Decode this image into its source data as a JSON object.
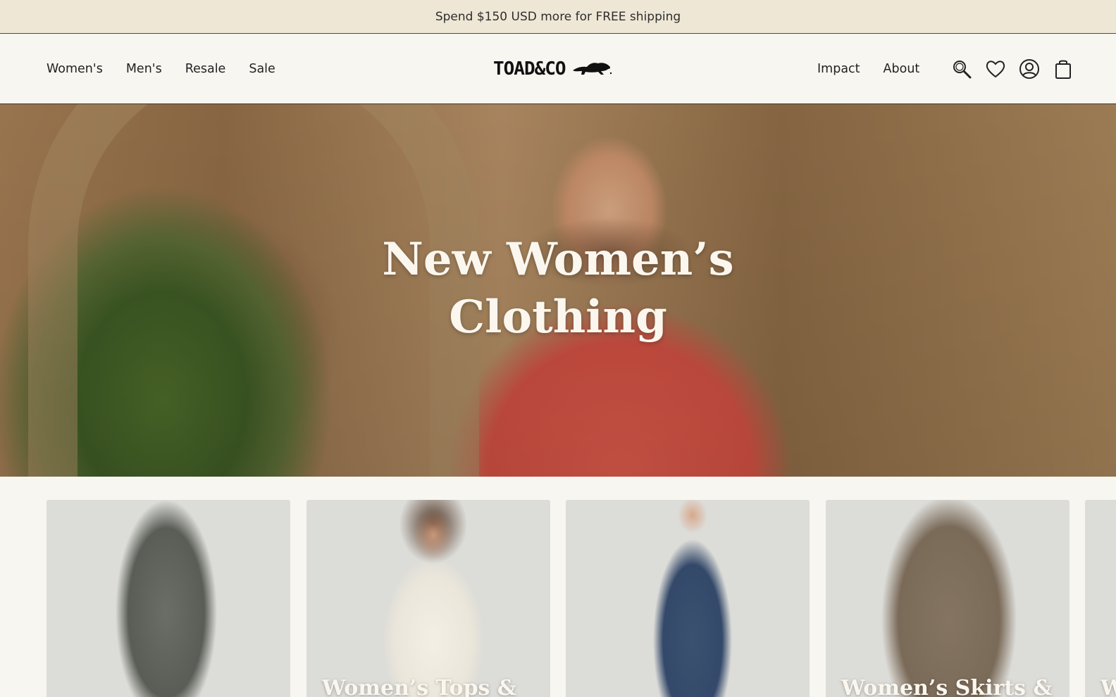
{
  "promo": {
    "text": "Spend $150 USD more for FREE shipping"
  },
  "nav": {
    "left": [
      {
        "label": "Women's"
      },
      {
        "label": "Men's"
      },
      {
        "label": "Resale"
      },
      {
        "label": "Sale"
      }
    ],
    "right": [
      {
        "label": "Impact"
      },
      {
        "label": "About"
      }
    ]
  },
  "logo": {
    "text": "TOAD&CO"
  },
  "icons": [
    "search-icon",
    "heart-icon",
    "account-icon",
    "bag-icon"
  ],
  "hero": {
    "title_line1": "New Women’s",
    "title_line2": "Clothing"
  },
  "cards": [
    {
      "label": ""
    },
    {
      "label": "Women’s Tops &"
    },
    {
      "label": ""
    },
    {
      "label": "Women’s Skirts &"
    },
    {
      "label": "W"
    }
  ],
  "colors": {
    "promo_bg": "#efe7d6",
    "page_bg": "#f8f6f1",
    "text_light": "#fbf7ef"
  }
}
